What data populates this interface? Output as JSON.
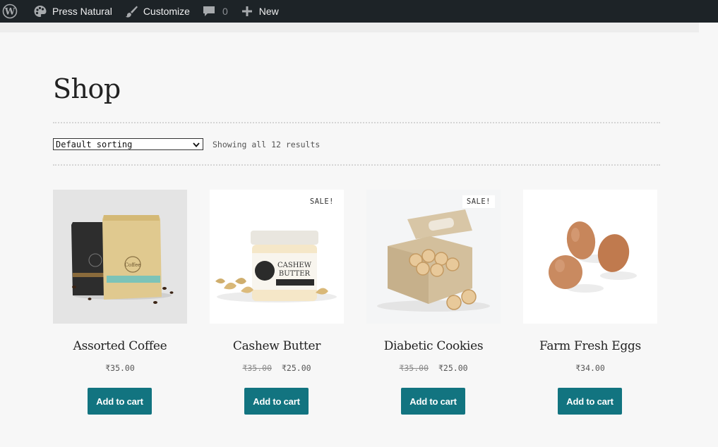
{
  "adminbar": {
    "site_name": "Press Natural",
    "customize_label": "Customize",
    "comments_count": "0",
    "new_label": "New",
    "icons": [
      "wordpress-icon",
      "palette-icon",
      "brush-icon",
      "comment-icon",
      "plus-icon"
    ]
  },
  "page": {
    "title": "Shop",
    "sorting_value": "Default sorting",
    "result_count": "Showing all 12 results"
  },
  "products": [
    {
      "name": "Assorted Coffee",
      "price": "₹35.00",
      "old_price": "",
      "sale": "",
      "button": "Add to cart"
    },
    {
      "name": "Cashew Butter",
      "price": "₹25.00",
      "old_price": "₹35.00",
      "sale": "SALE!",
      "button": "Add to cart"
    },
    {
      "name": "Diabetic Cookies",
      "price": "₹25.00",
      "old_price": "₹35.00",
      "sale": "SALE!",
      "button": "Add to cart"
    },
    {
      "name": "Farm Fresh Eggs",
      "price": "₹34.00",
      "old_price": "",
      "sale": "",
      "button": "Add to cart"
    }
  ],
  "colors": {
    "adminbar_bg": "#1d2327",
    "button_bg": "#127480",
    "page_bg": "#f7f7f7"
  }
}
